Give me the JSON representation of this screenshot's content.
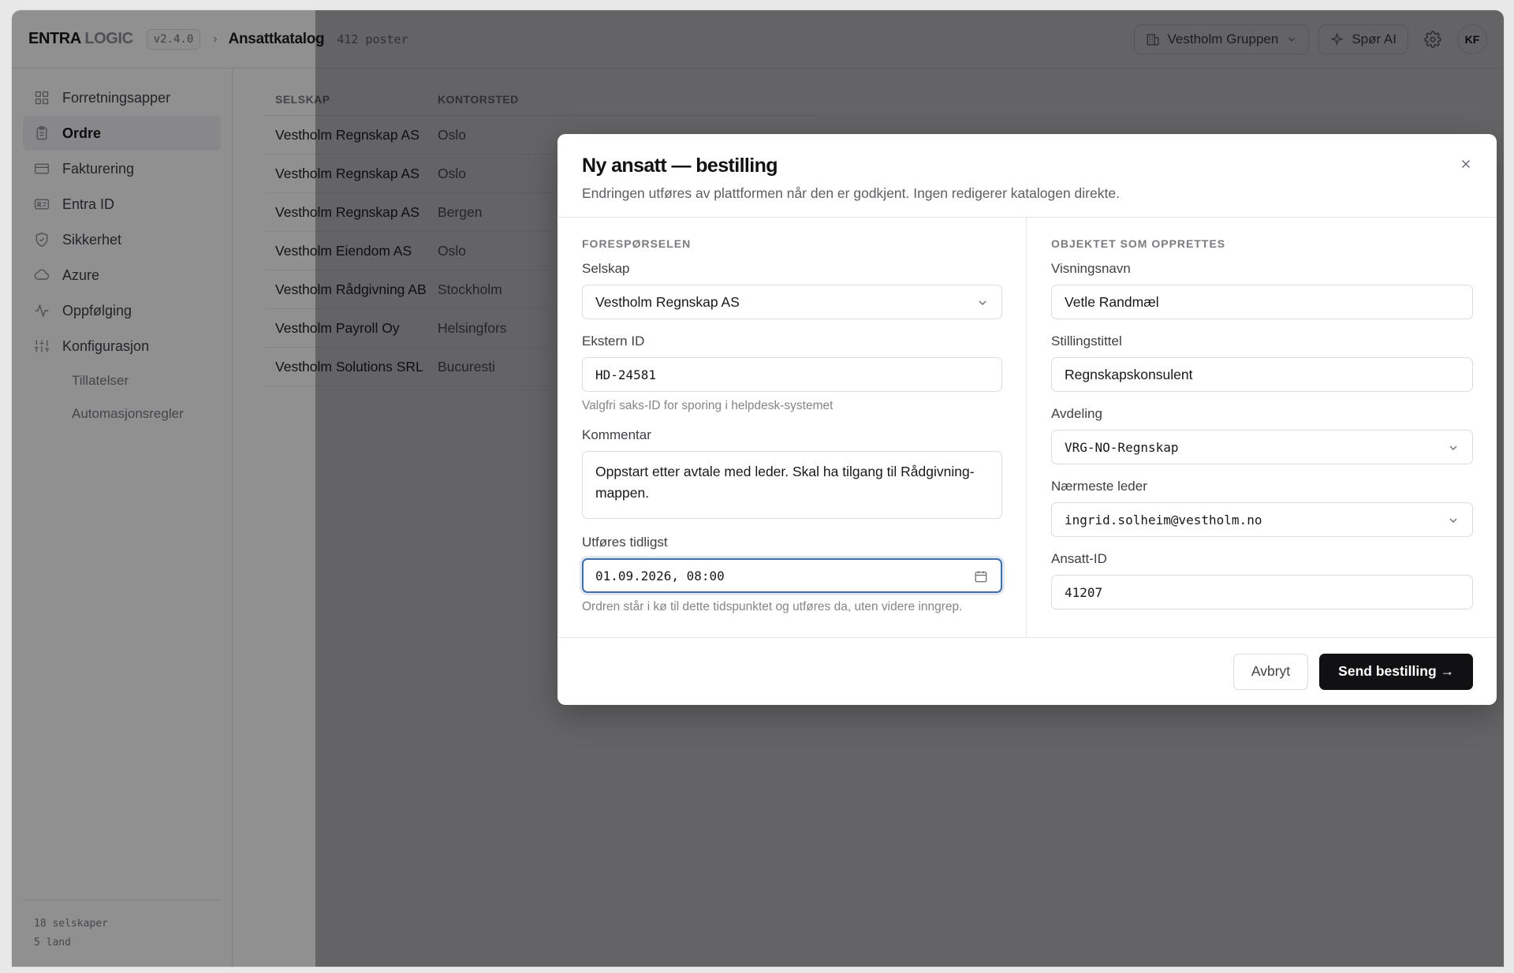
{
  "header": {
    "logo_main": "ENTRA",
    "logo_light": "LOGIC",
    "version": "v2.4.0",
    "separator": "›",
    "page_title": "Ansattkatalog",
    "record_count": "412 poster",
    "tenant": "Vestholm Gruppen",
    "ask_ai": "Spør AI",
    "avatar": "KF"
  },
  "sidebar": {
    "items": [
      {
        "label": "Forretningsapper",
        "icon": "grid-icon",
        "active": false
      },
      {
        "label": "Ordre",
        "icon": "clipboard-icon",
        "active": true
      },
      {
        "label": "Fakturering",
        "icon": "credit-card-icon",
        "active": false
      },
      {
        "label": "Entra ID",
        "icon": "id-card-icon",
        "active": false
      },
      {
        "label": "Sikkerhet",
        "icon": "shield-icon",
        "active": false
      },
      {
        "label": "Azure",
        "icon": "cloud-icon",
        "active": false
      },
      {
        "label": "Oppfølging",
        "icon": "activity-icon",
        "active": false
      },
      {
        "label": "Konfigurasjon",
        "icon": "sliders-icon",
        "active": false
      }
    ],
    "subitems": [
      "Tillatelser",
      "Automasjonsregler"
    ],
    "footer": {
      "companies": "18 selskaper",
      "countries": "5 land"
    }
  },
  "table": {
    "columns": [
      "SELSKAP",
      "KONTORSTED"
    ],
    "rows": [
      {
        "company": "Vestholm Regnskap AS",
        "office": "Oslo"
      },
      {
        "company": "Vestholm Regnskap AS",
        "office": "Oslo"
      },
      {
        "company": "Vestholm Regnskap AS",
        "office": "Bergen"
      },
      {
        "company": "Vestholm Eiendom AS",
        "office": "Oslo"
      },
      {
        "company": "Vestholm Rådgivning AB",
        "office": "Stockholm"
      },
      {
        "company": "Vestholm Payroll Oy",
        "office": "Helsingfors"
      },
      {
        "company": "Vestholm Solutions SRL",
        "office": "Bucuresti"
      }
    ]
  },
  "modal": {
    "title": "Ny ansatt — bestilling",
    "subtitle": "Endringen utføres av plattformen når den er godkjent. Ingen redigerer katalogen direkte.",
    "left": {
      "section": "FORESPØRSELEN",
      "company_label": "Selskap",
      "company_value": "Vestholm Regnskap AS",
      "external_id_label": "Ekstern ID",
      "external_id_value": "HD-24581",
      "external_id_hint": "Valgfri saks-ID for sporing i helpdesk-systemet",
      "comment_label": "Kommentar",
      "comment_value": "Oppstart etter avtale med leder. Skal ha tilgang til Rådgivning-mappen.",
      "earliest_label": "Utføres tidligst",
      "earliest_value": "01.09.2026, 08:00",
      "earliest_hint": "Ordren står i kø til dette tidspunktet og utføres da, uten videre inngrep."
    },
    "right": {
      "section": "OBJEKTET SOM OPPRETTES",
      "display_name_label": "Visningsnavn",
      "display_name_value": "Vetle Randmæl",
      "job_title_label": "Stillingstittel",
      "job_title_value": "Regnskapskonsulent",
      "department_label": "Avdeling",
      "department_value": "VRG-NO-Regnskap",
      "manager_label": "Nærmeste leder",
      "manager_value": "ingrid.solheim@vestholm.no",
      "employee_id_label": "Ansatt-ID",
      "employee_id_value": "41207"
    },
    "cancel_label": "Avbryt",
    "submit_label": "Send bestilling →"
  },
  "colors": {
    "accent": "#111114",
    "focus": "#3f6ea8",
    "overlay": "rgba(9,9,11,0.45)"
  }
}
